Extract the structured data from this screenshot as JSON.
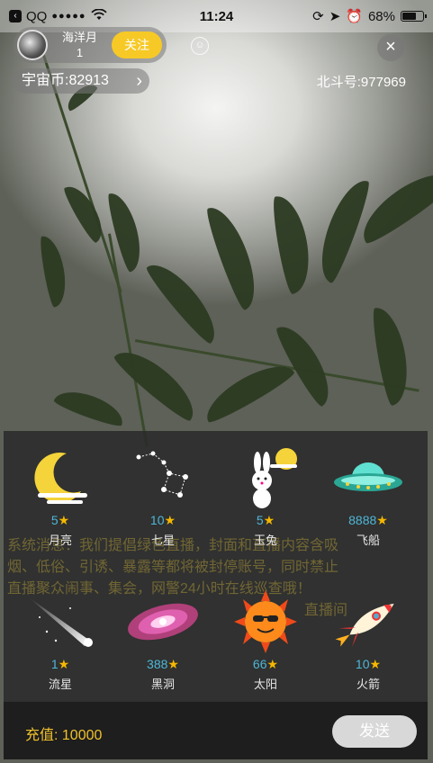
{
  "status_bar": {
    "carrier": "QQ",
    "signal": "●●●●●",
    "time": "11:24",
    "battery": "68%",
    "battery_level": 0.68
  },
  "host": {
    "name": "海洋月",
    "level": "1",
    "follow_label": "关注"
  },
  "coins_label": "宇宙币:82913",
  "beidou_id": "北斗号:977969",
  "chat_overlay": {
    "line1": "系统消息：我们提倡绿色直播，封面和直播内容含吸",
    "line2": "烟、低俗、引诱、暴露等都将被封停账号，同时禁止",
    "line3": "直播聚众闹事、集会，网警24小时在线巡查哦！",
    "line4": "直播间"
  },
  "gifts": [
    {
      "name": "月亮",
      "price": "5",
      "icon": "moon-icon"
    },
    {
      "name": "七星",
      "price": "10",
      "icon": "constellation-icon"
    },
    {
      "name": "玉兔",
      "price": "5",
      "icon": "rabbit-icon"
    },
    {
      "name": "飞船",
      "price": "8888",
      "icon": "ufo-icon"
    },
    {
      "name": "流星",
      "price": "1",
      "icon": "meteor-icon"
    },
    {
      "name": "黑洞",
      "price": "388",
      "icon": "blackhole-icon"
    },
    {
      "name": "太阳",
      "price": "66",
      "icon": "sun-icon"
    },
    {
      "name": "火箭",
      "price": "10",
      "icon": "rocket-icon"
    }
  ],
  "star_glyph": "★",
  "recharge_label": "充值: 10000",
  "send_label": "发送",
  "colors": {
    "accent_yellow": "#f7c926",
    "price_blue": "#4fb6d8",
    "star": "#f5b800"
  }
}
